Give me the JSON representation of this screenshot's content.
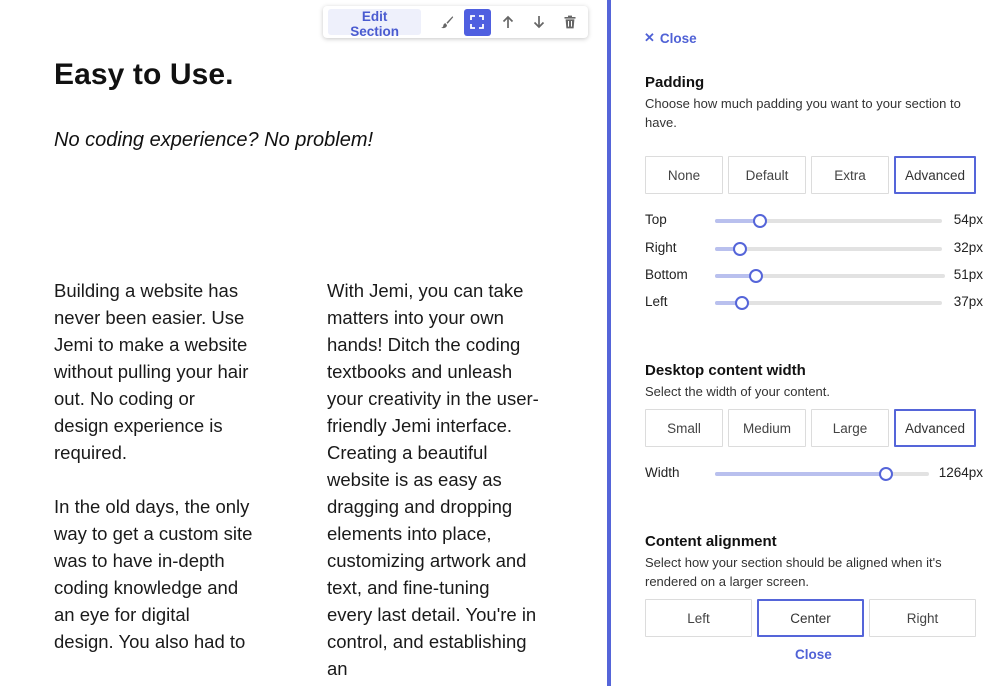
{
  "toolbar": {
    "edit_label": "Edit Section",
    "icons": [
      "brush-icon",
      "expand-icon",
      "arrow-up-icon",
      "arrow-down-icon",
      "trash-icon"
    ],
    "accent": "#4f5fe0"
  },
  "content": {
    "headline": "Easy to Use.",
    "subhead": "No coding experience? No problem!",
    "col1_p1": "Building a website has never been easier. Use Jemi to make a website without pulling your hair out. No coding or design experience is required.",
    "col1_p2": "In the old days, the only way to get a custom site was to have in-depth coding knowledge and an eye for digital design. You also had to",
    "col2_p1": "With Jemi, you can take matters into your own hands! Ditch the coding textbooks and unleash your creativity in the user-friendly Jemi interface. Creating a beautiful website is as easy as dragging and dropping elements into place, customizing artwork and text, and fine-tuning every last detail. You're in control, and establishing an"
  },
  "panel": {
    "close_top": "Close",
    "close_bottom": "Close",
    "accent": "#5565d9",
    "padding": {
      "title": "Padding",
      "desc": "Choose how much padding you want to your section to have.",
      "options": [
        "None",
        "Default",
        "Extra",
        "Advanced"
      ],
      "selected": "Advanced",
      "sliders": [
        {
          "label": "Top",
          "value_text": "54px",
          "level": 0.2
        },
        {
          "label": "Right",
          "value_text": "32px",
          "level": 0.11
        },
        {
          "label": "Bottom",
          "value_text": "51px",
          "level": 0.18
        },
        {
          "label": "Left",
          "value_text": "37px",
          "level": 0.12
        }
      ]
    },
    "width": {
      "title": "Desktop content width",
      "desc": "Select the width of your content.",
      "options": [
        "Small",
        "Medium",
        "Large",
        "Advanced"
      ],
      "selected": "Advanced",
      "slider": {
        "label": "Width",
        "value_text": "1264px",
        "level": 0.8
      }
    },
    "alignment": {
      "title": "Content alignment",
      "desc": "Select how your section should be aligned when it's rendered on a larger screen.",
      "options": [
        "Left",
        "Center",
        "Right"
      ],
      "selected": "Center"
    }
  }
}
